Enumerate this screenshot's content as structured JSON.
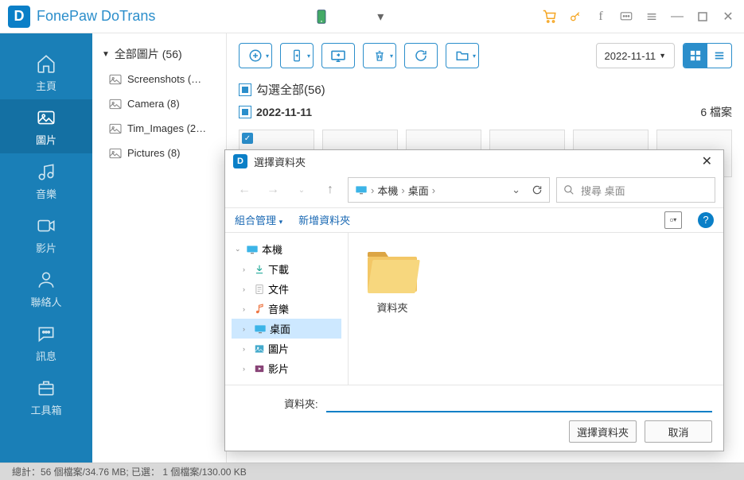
{
  "app": {
    "title": "FonePaw DoTrans"
  },
  "titlebar": {
    "device_dropdown": "▾"
  },
  "nav": {
    "home": "主頁",
    "photos": "圖片",
    "music": "音樂",
    "videos": "影片",
    "contacts": "聯絡人",
    "messages": "訊息",
    "toolbox": "工具箱"
  },
  "folders": {
    "header": "全部圖片 (56)",
    "items": [
      {
        "label": "Screenshots (…"
      },
      {
        "label": "Camera (8)"
      },
      {
        "label": "Tim_Images (2…"
      },
      {
        "label": "Pictures (8)"
      }
    ]
  },
  "toolbar": {
    "date": "2022-11-11"
  },
  "content": {
    "select_all": "勾選全部(56)",
    "date_group": "2022-11-11",
    "file_count": "6 檔案"
  },
  "status": "總計：56 個檔案/34.76 MB; 已選： 1 個檔案/130.00 KB",
  "dialog": {
    "title": "選擇資料夾",
    "breadcrumb": {
      "root": "本機",
      "leaf": "桌面"
    },
    "search_placeholder": "搜尋 桌面",
    "organize": "組合管理",
    "new_folder": "新增資料夾",
    "tree": {
      "root": "本機",
      "downloads": "下載",
      "documents": "文件",
      "music": "音樂",
      "desktop": "桌面",
      "pictures": "圖片",
      "videos": "影片"
    },
    "tile": "資料夾",
    "footer_label": "資料夾:",
    "ok": "選擇資料夾",
    "cancel": "取消"
  }
}
